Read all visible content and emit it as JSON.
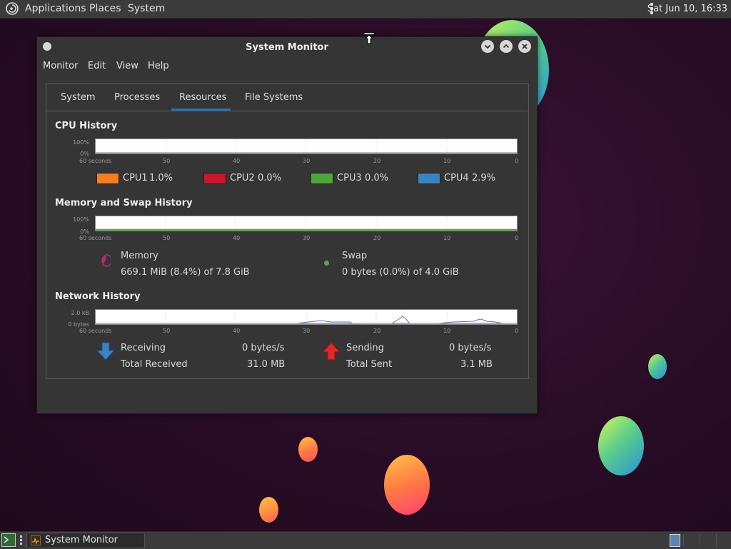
{
  "top_panel": {
    "menus": [
      "Applications",
      "Places",
      "System"
    ],
    "clock": "Sat Jun 10, 16:33"
  },
  "window": {
    "title": "System Monitor",
    "menubar": [
      "Monitor",
      "Edit",
      "View",
      "Help"
    ],
    "tabs": [
      "System",
      "Processes",
      "Resources",
      "File Systems"
    ],
    "active_tab": "Resources"
  },
  "cpu": {
    "title": "CPU History",
    "y_labels": [
      "100%",
      "0%"
    ],
    "x_labels": [
      "60 seconds",
      "50",
      "40",
      "30",
      "20",
      "10",
      "0"
    ],
    "legend": [
      {
        "name": "CPU1",
        "value": "1.0%",
        "color": "#f47f1f"
      },
      {
        "name": "CPU2",
        "value": "0.0%",
        "color": "#c9152d"
      },
      {
        "name": "CPU3",
        "value": "0.0%",
        "color": "#4ca63b"
      },
      {
        "name": "CPU4",
        "value": "2.9%",
        "color": "#3a84c2"
      }
    ]
  },
  "memory": {
    "title": "Memory and Swap History",
    "y_labels": [
      "100%",
      "0%"
    ],
    "x_labels": [
      "60 seconds",
      "50",
      "40",
      "30",
      "20",
      "10",
      "0"
    ],
    "memory_label": "Memory",
    "memory_value": "669.1 MiB (8.4%) of 7.8 GiB",
    "memory_color": "#c2247a",
    "swap_label": "Swap",
    "swap_value": "0 bytes (0.0%) of 4.0 GiB",
    "swap_color": "#4caf50"
  },
  "network": {
    "title": "Network History",
    "y_labels": [
      "2.0 kB",
      "0 bytes"
    ],
    "x_labels": [
      "60 seconds",
      "50",
      "40",
      "30",
      "20",
      "10",
      "0"
    ],
    "receiving_label": "Receiving",
    "receiving_value": "0 bytes/s",
    "total_received_label": "Total Received",
    "total_received_value": "31.0 MB",
    "sending_label": "Sending",
    "sending_value": "0 bytes/s",
    "total_sent_label": "Total Sent",
    "total_sent_value": "3.1 MB",
    "receive_color": "#3a84c2",
    "send_color": "#d8262a"
  },
  "taskbar": {
    "task_label": "System Monitor"
  }
}
